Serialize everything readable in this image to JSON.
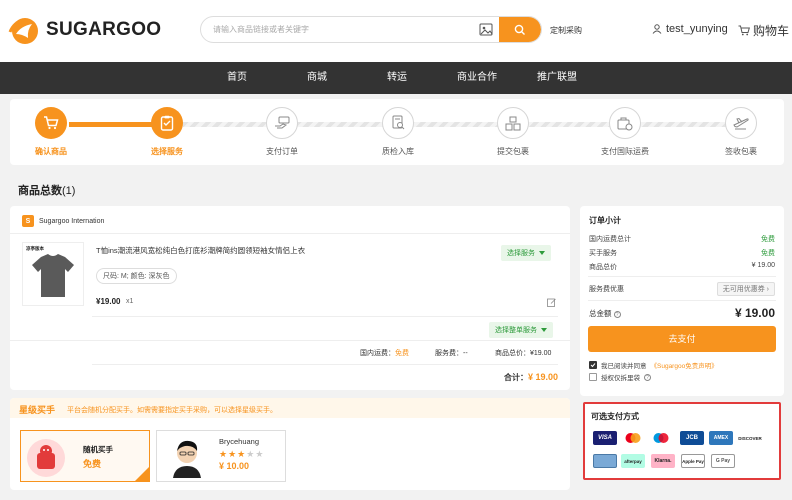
{
  "header": {
    "logo_text": "SUGARGOO",
    "search_placeholder": "请输入商品链接或者关键字",
    "custom_purchase": "定制采购",
    "username": "test_yunying",
    "cart_label": "购物车"
  },
  "nav": {
    "items": [
      "首页",
      "商城",
      "转运",
      "商业合作",
      "推广联盟"
    ]
  },
  "steps": [
    {
      "label": "确认商品",
      "state": "done",
      "icon": "cart-icon"
    },
    {
      "label": "选择服务",
      "state": "current",
      "icon": "checklist-icon"
    },
    {
      "label": "支付订单",
      "state": "todo",
      "icon": "payment-hand-icon"
    },
    {
      "label": "质检入库",
      "state": "todo",
      "icon": "inspection-icon"
    },
    {
      "label": "提交包裹",
      "state": "todo",
      "icon": "package-boxes-icon"
    },
    {
      "label": "支付国际运费",
      "state": "todo",
      "icon": "shipping-fee-icon"
    },
    {
      "label": "签收包裹",
      "state": "todo",
      "icon": "airplane-icon"
    }
  ],
  "order": {
    "total_label": "商品总数",
    "total_count": "(1)",
    "shop_name": "Sugargoo Internation",
    "product": {
      "image_caption": "凉亭版本",
      "title": "T恤ins潮流港风宽松纯白色打底衫潮牌简约圆领短袖女情侣上衣",
      "spec": "尺码: M; 颜色: 深灰色",
      "price": "¥19.00",
      "qty": "x1",
      "service_tag": "选择服务"
    },
    "whole_service_tag": "选择整单服务",
    "domestic_fee_label": "国内运费：",
    "domestic_fee_value": "免费",
    "service_fee_label": "服务费：",
    "service_fee_value": "--",
    "goods_total_label": "商品总价：",
    "goods_total_value": "¥19.00",
    "subtotal_label": "合计：",
    "subtotal_value": "¥ 19.00"
  },
  "summary": {
    "title": "订单小计",
    "rows": [
      {
        "label": "国内运费总计",
        "value": "免费"
      },
      {
        "label": "买手服务",
        "value": "免费"
      },
      {
        "label": "商品总价",
        "value": "¥ 19.00"
      }
    ],
    "coupon_label": "服务费优惠",
    "coupon_value": "无可用优惠券",
    "total_label": "总金额",
    "total_value": "¥ 19.00",
    "pay_button": "去支付",
    "agree_prefix": "我已阅读并同意",
    "agree_link": "《Sugargoo免责声明》",
    "auth_text": "授权仅拆里袋"
  },
  "payment": {
    "title": "可选支付方式",
    "methods": [
      "VISA",
      "mastercard",
      "maestro",
      "JCB",
      "AMEX",
      "DISCOVER",
      "card",
      "afterpay",
      "Klarna.",
      "Apple Pay",
      "G Pay"
    ]
  },
  "star_buyer": {
    "title": "星级买手",
    "desc": "平台会随机分配买手。如需需要指定买手采购，可以选择星级买手。",
    "random": {
      "name": "随机买手",
      "price": "免费"
    },
    "buyer": {
      "name": "Brycehuang",
      "rating": 3,
      "max_rating": 5,
      "price": "¥ 10.00"
    }
  },
  "colors": {
    "accent": "#f7931e",
    "green": "#2e9b3c",
    "nav_bg": "#333333",
    "highlight_border": "#e23b3b"
  }
}
